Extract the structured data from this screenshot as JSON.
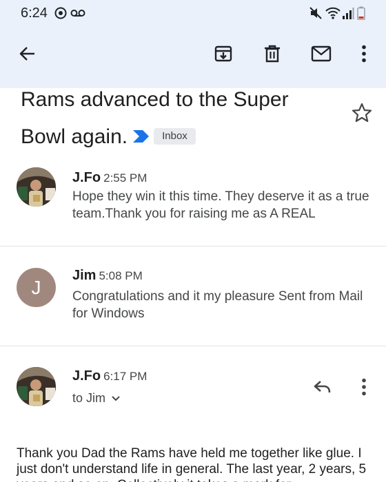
{
  "status_bar": {
    "time": "6:24",
    "icons": [
      "whatsapp-icon",
      "voicemail-icon",
      "mute-icon",
      "wifi-icon",
      "signal-icon",
      "battery-low-icon"
    ]
  },
  "app_bar": {
    "icons": [
      "back-arrow-icon",
      "archive-icon",
      "delete-icon",
      "mark-unread-icon",
      "more-vert-icon"
    ]
  },
  "thread": {
    "subject": "Rams advanced to the Super Bowl again.",
    "label": "Inbox",
    "colors": {
      "important_marker": "#1a73e8",
      "topbar_bg": "#eaf1fb"
    }
  },
  "messages": [
    {
      "sender": "J.Fo",
      "time": "2:55 PM",
      "snippet": "Hope they win it this time. They deserve it as a true team.Thank you for raising me as A REAL"
    },
    {
      "sender": "Jim",
      "avatar_letter": "J",
      "time": "5:08 PM",
      "snippet": "Congratulations and it my pleasure Sent from Mail for Windows"
    },
    {
      "sender": "J.Fo",
      "time": "6:17 PM",
      "to_line": "to Jim",
      "body": "Thank you Dad the Rams have held me together like glue. I just don't understand life in general. The last year, 2 years, 5 years and so on. Collectively it takes a mark for"
    }
  ]
}
